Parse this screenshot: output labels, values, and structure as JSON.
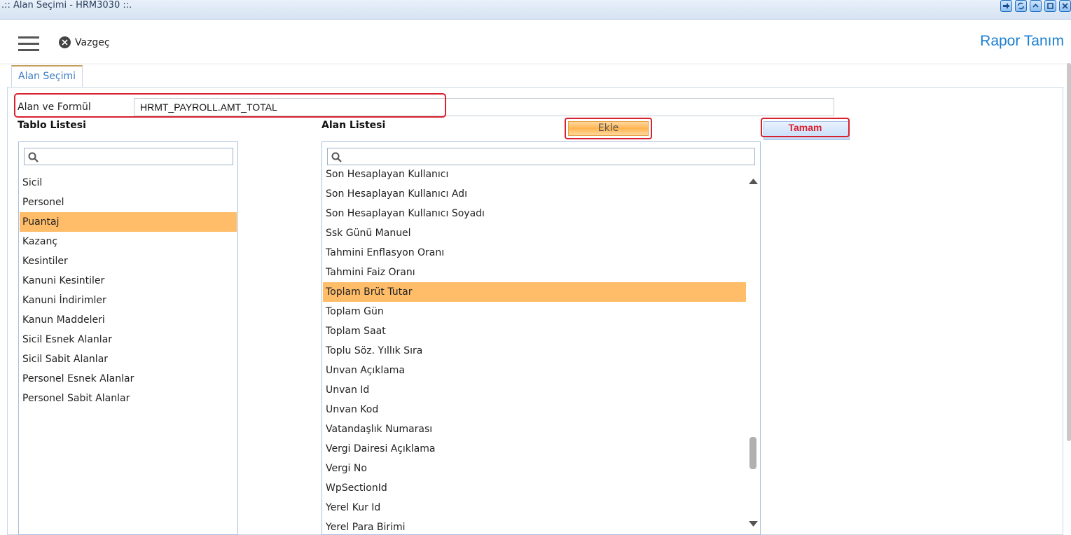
{
  "window": {
    "title": ".:: Alan Seçimi - HRM3030 ::."
  },
  "toolbar": {
    "cancel_label": "Vazgeç",
    "page_title": "Rapor Tanım"
  },
  "tab": {
    "label": "Alan Seçimi"
  },
  "formula": {
    "label": "Alan ve Formül",
    "value": "HRMT_PAYROLL.AMT_TOTAL"
  },
  "table_list": {
    "header": "Tablo Listesi",
    "items": [
      "Sicil",
      "Personel",
      "Puantaj",
      "Kazanç",
      "Kesintiler",
      "Kanuni Kesintiler",
      "Kanuni İndirimler",
      "Kanun Maddeleri",
      "Sicil Esnek Alanlar",
      "Sicil Sabit Alanlar",
      "Personel Esnek Alanlar",
      "Personel Sabit Alanlar"
    ],
    "selected": "Puantaj"
  },
  "field_list": {
    "header": "Alan Listesi",
    "items": [
      "Son Hesaplayan Kullanıcı",
      "Son Hesaplayan Kullanıcı Adı",
      "Son Hesaplayan Kullanıcı Soyadı",
      "Ssk Günü Manuel",
      "Tahmini Enflasyon Oranı",
      "Tahmini Faiz Oranı",
      "Toplam Brüt Tutar",
      "Toplam Gün",
      "Toplam Saat",
      "Toplu Söz. Yıllık Sıra",
      "Unvan Açıklama",
      "Unvan Id",
      "Unvan Kod",
      "Vatandaşlık Numarası",
      "Vergi Dairesi Açıklama",
      "Vergi No",
      "WpSectionId",
      "Yerel Kur Id",
      "Yerel Para Birimi"
    ],
    "selected": "Toplam Brüt Tutar"
  },
  "buttons": {
    "add_label": "Ekle",
    "ok_label": "Tamam"
  },
  "colors": {
    "accent": "#1b7ed0",
    "selection": "#ffbd6a",
    "highlight_border": "#d9202e"
  }
}
